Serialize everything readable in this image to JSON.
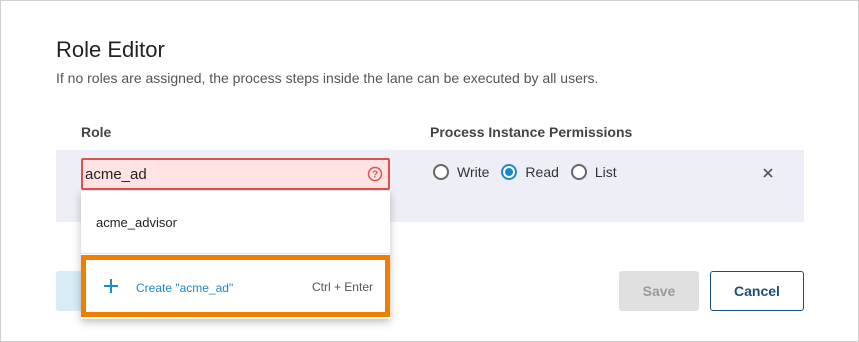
{
  "dialog": {
    "title": "Role Editor",
    "subtitle": "If no roles are assigned, the process steps inside the lane can be executed by all users."
  },
  "columns": {
    "role": "Role",
    "permissions": "Process Instance Permissions"
  },
  "role_input": {
    "value": "acme_ad",
    "state": "error",
    "error_icon": "question-circle-icon"
  },
  "permissions": [
    {
      "label": "Write",
      "checked": false
    },
    {
      "label": "Read",
      "checked": true
    },
    {
      "label": "List",
      "checked": false
    }
  ],
  "remove_icon": "close-icon",
  "dropdown": {
    "suggestions": [
      "acme_advisor"
    ],
    "create_label": "Create \"acme_ad\"",
    "create_icon": "plus-icon",
    "create_shortcut": "Ctrl + Enter"
  },
  "buttons": {
    "save": "Save",
    "cancel": "Cancel"
  },
  "colors": {
    "accent": "#1e88c9",
    "error": "#d9534f",
    "error_bg": "#ffe3e3",
    "highlight": "#f07f00"
  }
}
